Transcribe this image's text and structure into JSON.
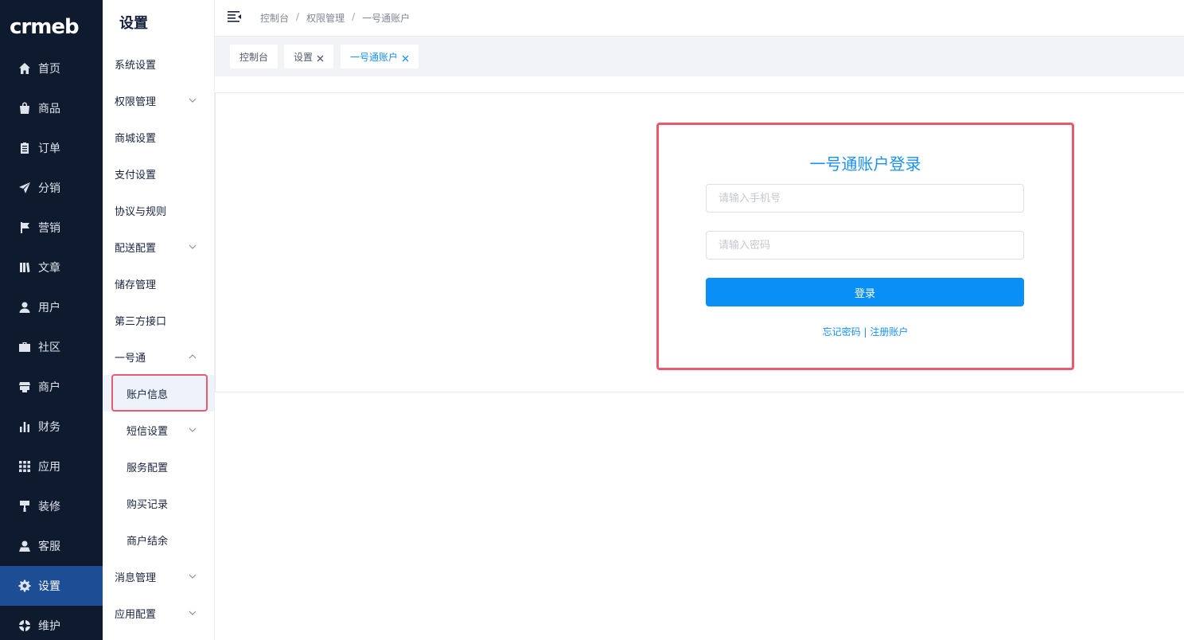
{
  "brand": {
    "logo_text": "crmeb"
  },
  "rail": {
    "items": [
      {
        "label": "首页",
        "icon": "home-icon"
      },
      {
        "label": "商品",
        "icon": "shopping-bag-icon"
      },
      {
        "label": "订单",
        "icon": "clipboard-icon"
      },
      {
        "label": "分销",
        "icon": "paper-plane-icon"
      },
      {
        "label": "营销",
        "icon": "flag-icon"
      },
      {
        "label": "文章",
        "icon": "book-icon"
      },
      {
        "label": "用户",
        "icon": "user-icon"
      },
      {
        "label": "社区",
        "icon": "briefcase-icon"
      },
      {
        "label": "商户",
        "icon": "store-icon"
      },
      {
        "label": "财务",
        "icon": "bar-chart-icon"
      },
      {
        "label": "应用",
        "icon": "grid-icon"
      },
      {
        "label": "装修",
        "icon": "paint-roller-icon"
      },
      {
        "label": "客服",
        "icon": "support-agent-icon"
      },
      {
        "label": "设置",
        "icon": "gear-icon"
      },
      {
        "label": "维护",
        "icon": "lifebuoy-icon"
      }
    ],
    "active": "设置"
  },
  "submenu": {
    "title": "设置",
    "items": [
      {
        "label": "系统设置"
      },
      {
        "label": "权限管理"
      },
      {
        "label": "商城设置"
      },
      {
        "label": "支付设置"
      },
      {
        "label": "协议与规则"
      },
      {
        "label": "配送配置"
      },
      {
        "label": "储存管理"
      },
      {
        "label": "第三方接口"
      },
      {
        "label": "一号通"
      },
      {
        "label": "账户信息"
      },
      {
        "label": "短信设置"
      },
      {
        "label": "服务配置"
      },
      {
        "label": "购买记录"
      },
      {
        "label": "商户结余"
      },
      {
        "label": "消息管理"
      },
      {
        "label": "应用配置"
      }
    ]
  },
  "header": {
    "breadcrumb": [
      "控制台",
      "权限管理",
      "一号通账户"
    ],
    "separator": "/"
  },
  "tabs": [
    {
      "label": "控制台"
    },
    {
      "label": "设置"
    },
    {
      "label": "一号通账户"
    }
  ],
  "login": {
    "title": "一号通账户登录",
    "phone_placeholder": "请输入手机号",
    "password_placeholder": "请输入密码",
    "submit_label": "登录",
    "forgot_label": "忘记密码",
    "divider": "|",
    "register_label": "注册账户"
  },
  "colors": {
    "rail_bg": "#0e1a2e",
    "rail_active": "#1c4d95",
    "accent": "#1890ff",
    "button": "#0a8ff7",
    "highlight": "#e95a6e"
  }
}
